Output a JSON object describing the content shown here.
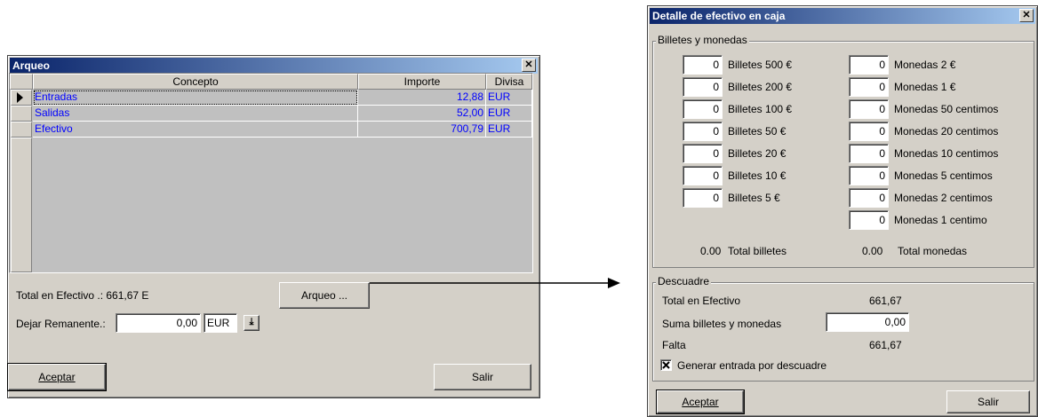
{
  "arqueo": {
    "title": "Arqueo",
    "columns": [
      "Concepto",
      "Importe",
      "Divisa"
    ],
    "rows": [
      {
        "concepto": "Entradas",
        "importe": "12,88",
        "divisa": "EUR"
      },
      {
        "concepto": "Salidas",
        "importe": "52,00",
        "divisa": "EUR"
      },
      {
        "concepto": "Efectivo",
        "importe": "700,79",
        "divisa": "EUR"
      }
    ],
    "total_label": "Total en Efectivo .: 661,67 E",
    "arqueo_button": "Arqueo ...",
    "dejar_label": "Dejar Remanente.:",
    "dejar_value": "0,00",
    "dejar_currency": "EUR",
    "aceptar": "Aceptar",
    "salir": "Salir"
  },
  "detalle": {
    "title": "Detalle de efectivo en caja",
    "group1_title": "Billetes y monedas",
    "billetes": [
      {
        "value": "0",
        "label": "Billetes 500 €"
      },
      {
        "value": "0",
        "label": "Billetes 200 €"
      },
      {
        "value": "0",
        "label": "Billetes 100 €"
      },
      {
        "value": "0",
        "label": "Billetes 50 €"
      },
      {
        "value": "0",
        "label": "Billetes 20 €"
      },
      {
        "value": "0",
        "label": "Billetes 10 €"
      },
      {
        "value": "0",
        "label": "Billetes 5 €"
      }
    ],
    "monedas": [
      {
        "value": "0",
        "label": "Monedas 2 €"
      },
      {
        "value": "0",
        "label": "Monedas 1 €"
      },
      {
        "value": "0",
        "label": "Monedas 50 centimos"
      },
      {
        "value": "0",
        "label": "Monedas 20 centimos"
      },
      {
        "value": "0",
        "label": "Monedas 10 centimos"
      },
      {
        "value": "0",
        "label": "Monedas 5 centimos"
      },
      {
        "value": "0",
        "label": "Monedas 2 centimos"
      },
      {
        "value": "0",
        "label": "Monedas 1 centimo"
      }
    ],
    "total_billetes_value": "0.00",
    "total_billetes_label": "Total billetes",
    "total_monedas_value": "0.00",
    "total_monedas_label": "Total monedas",
    "group2_title": "Descuadre",
    "total_efectivo_label": "Total en Efectivo",
    "total_efectivo_value": "661,67",
    "suma_label": "Suma billetes y monedas",
    "suma_value": "0,00",
    "falta_label": "Falta",
    "falta_value": "661,67",
    "checkbox_label": "Generar entrada por descuadre",
    "checkbox_checked": true,
    "aceptar": "Aceptar",
    "salir": "Salir"
  }
}
